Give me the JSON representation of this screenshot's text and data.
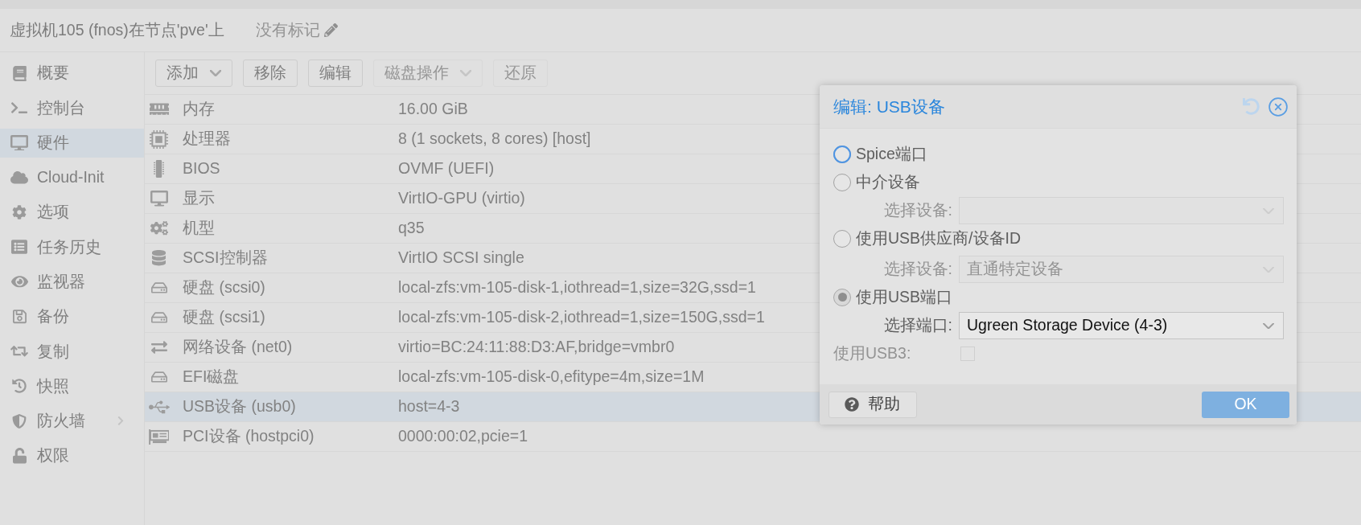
{
  "header": {
    "title": "虚拟机105 (fnos)在节点'pve'上",
    "tags": "没有标记"
  },
  "sidebar": {
    "items": [
      {
        "label": "概要",
        "selected": false
      },
      {
        "label": "控制台",
        "selected": false
      },
      {
        "label": "硬件",
        "selected": true
      },
      {
        "label": "Cloud-Init",
        "selected": false
      },
      {
        "label": "选项",
        "selected": false
      },
      {
        "label": "任务历史",
        "selected": false
      },
      {
        "label": "监视器",
        "selected": false
      },
      {
        "label": "备份",
        "selected": false
      },
      {
        "label": "复制",
        "selected": false
      },
      {
        "label": "快照",
        "selected": false
      },
      {
        "label": "防火墙",
        "selected": false,
        "expanded": false
      },
      {
        "label": "权限",
        "selected": false
      }
    ]
  },
  "toolbar": {
    "buttons": [
      {
        "label": "添加",
        "kind": "menu",
        "disabled": false
      },
      {
        "label": "移除",
        "kind": "button",
        "disabled": false
      },
      {
        "label": "编辑",
        "kind": "button",
        "disabled": false
      },
      {
        "label": "磁盘操作",
        "kind": "menu",
        "disabled": true
      },
      {
        "label": "还原",
        "kind": "button",
        "disabled": true
      }
    ]
  },
  "hardware": {
    "rows": [
      {
        "name": "内存",
        "value": "16.00 GiB",
        "selected": false
      },
      {
        "name": "处理器",
        "value": "8 (1 sockets, 8 cores) [host]",
        "selected": false
      },
      {
        "name": "BIOS",
        "value": "OVMF (UEFI)",
        "selected": false
      },
      {
        "name": "显示",
        "value": "VirtIO-GPU (virtio)",
        "selected": false
      },
      {
        "name": "机型",
        "value": "q35",
        "selected": false
      },
      {
        "name": "SCSI控制器",
        "value": "VirtIO SCSI single",
        "selected": false
      },
      {
        "name": "硬盘 (scsi0)",
        "value": "local-zfs:vm-105-disk-1,iothread=1,size=32G,ssd=1",
        "selected": false
      },
      {
        "name": "硬盘 (scsi1)",
        "value": "local-zfs:vm-105-disk-2,iothread=1,size=150G,ssd=1",
        "selected": false
      },
      {
        "name": "网络设备 (net0)",
        "value": "virtio=BC:24:11:88:D3:AF,bridge=vmbr0",
        "selected": false
      },
      {
        "name": "EFI磁盘",
        "value": "local-zfs:vm-105-disk-0,efitype=4m,size=1M",
        "selected": false
      },
      {
        "name": "USB设备 (usb0)",
        "value": "host=4-3",
        "selected": true
      },
      {
        "name": "PCI设备 (hostpci0)",
        "value": "0000:00:02,pcie=1",
        "selected": false
      }
    ]
  },
  "dialog": {
    "title": "编辑: USB设备",
    "tools": [
      {
        "kind": "reset",
        "disabled": true
      },
      {
        "kind": "close",
        "disabled": false
      }
    ],
    "options": [
      {
        "label": "Spice端口",
        "selected": false,
        "focused": true
      },
      {
        "label": "中介设备",
        "selected": false,
        "focused": false,
        "field": {
          "label": "选择设备:",
          "disabled": true
        }
      },
      {
        "label": "使用USB供应商/设备ID",
        "selected": false,
        "focused": false,
        "field": {
          "label": "选择设备:",
          "placeholder": "直通特定设备",
          "disabled": true
        }
      },
      {
        "label": "使用USB端口",
        "selected": true,
        "focused": false,
        "field": {
          "label": "选择端口:",
          "value": "Ugreen Storage Device (4-3)",
          "disabled": false
        }
      }
    ],
    "usb3": {
      "label": "使用USB3:",
      "checked": false,
      "disabled": true
    },
    "buttons": [
      {
        "kind": "help",
        "label": "帮助",
        "disabled": false
      },
      {
        "kind": "primary",
        "label": "OK",
        "disabled": true
      }
    ]
  }
}
